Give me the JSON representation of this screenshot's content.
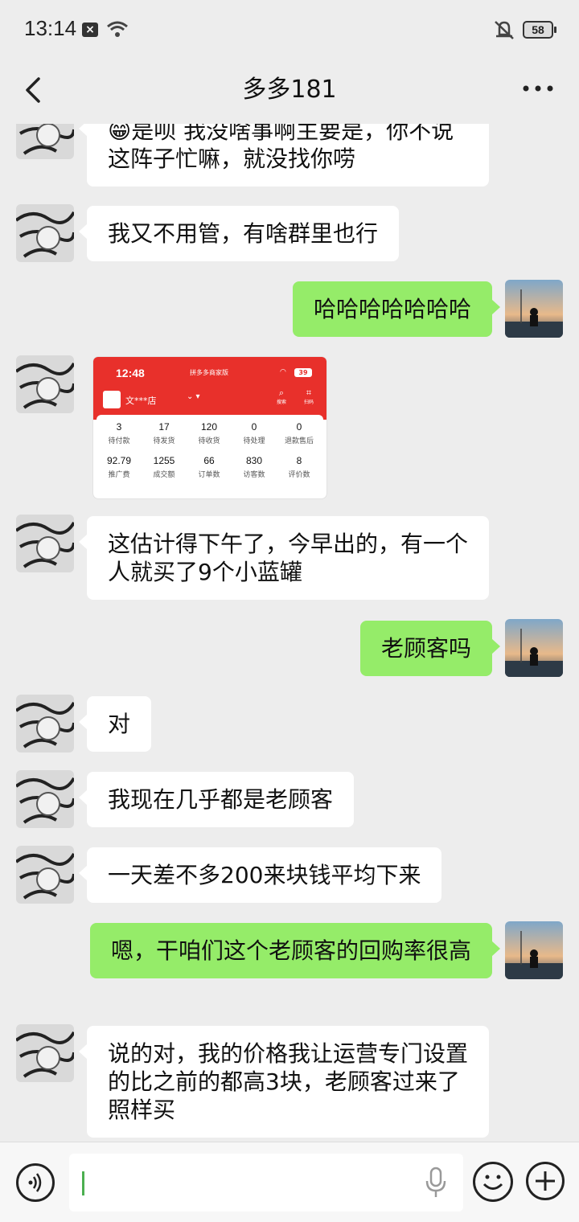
{
  "status_bar": {
    "time": "13:14",
    "battery": "58"
  },
  "header": {
    "title": "多多181"
  },
  "messages": [
    {
      "side": "left",
      "text": "😁是呗 我没啥事啊主要是，你不说这阵子忙嘛，就没找你唠"
    },
    {
      "side": "left",
      "text": "我又不用管，有啥群里也行"
    },
    {
      "side": "right",
      "text": "哈哈哈哈哈哈哈"
    },
    {
      "side": "left",
      "type": "image"
    },
    {
      "side": "left",
      "text": "这估计得下午了，今早出的，有一个人就买了9个小蓝罐"
    },
    {
      "side": "right",
      "text": "老顾客吗"
    },
    {
      "side": "left",
      "text": "对"
    },
    {
      "side": "left",
      "text": "我现在几乎都是老顾客"
    },
    {
      "side": "left",
      "text": "一天差不多200来块钱平均下来"
    },
    {
      "side": "right",
      "text": "嗯，干咱们这个老顾客的回购率很高"
    },
    {
      "side": "left",
      "text": "说的对，我的价格我让运营专门设置的比之前的都高3块，老顾客过来了照样买"
    }
  ],
  "shared_screenshot": {
    "time": "12:48",
    "app_name": "拼多多商家版",
    "battery": "39",
    "store_name": "文***店",
    "search_label": "搜索",
    "scan_label": "扫码",
    "stats": [
      {
        "value": "3",
        "label": "待付款"
      },
      {
        "value": "17",
        "label": "待发货"
      },
      {
        "value": "120",
        "label": "待收货"
      },
      {
        "value": "0",
        "label": "待处理"
      },
      {
        "value": "0",
        "label": "退款售后"
      },
      {
        "value": "92.79",
        "label": "推广费"
      },
      {
        "value": "1255",
        "label": "成交额"
      },
      {
        "value": "66",
        "label": "订单数"
      },
      {
        "value": "830",
        "label": "访客数"
      },
      {
        "value": "8",
        "label": "评价数"
      }
    ]
  },
  "colors": {
    "background": "#ededed",
    "sent_bubble": "#95ec69",
    "received_bubble": "#ffffff",
    "shop_header": "#e8302b"
  }
}
